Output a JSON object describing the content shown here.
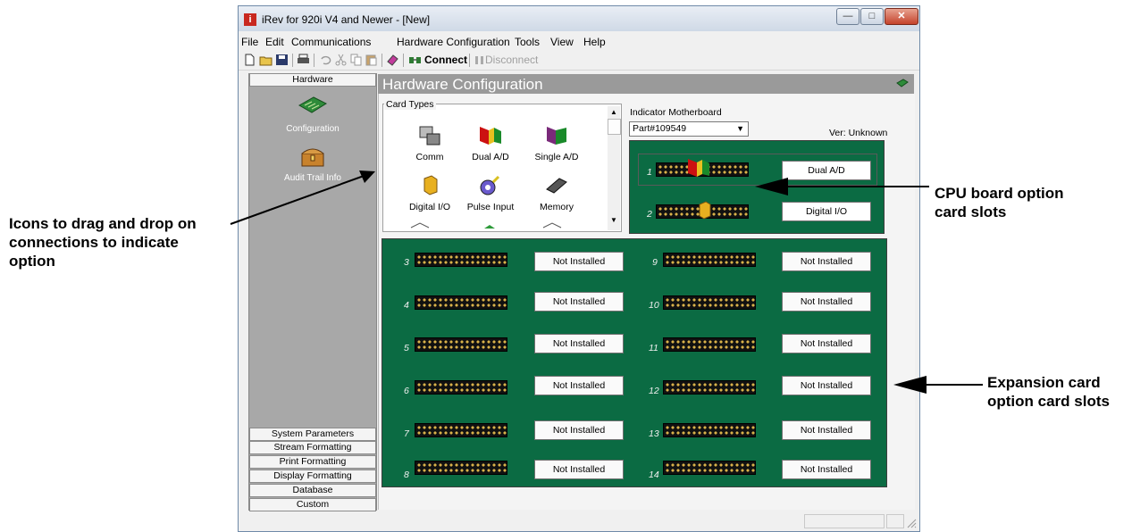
{
  "annotations": {
    "left_note": "Icons to drag and drop on\nconnections to indicate\noption",
    "cpu_note": "CPU board option\ncard slots",
    "exp_note": "Expansion card\noption card slots"
  },
  "window": {
    "title": "iRev for 920i V4 and Newer - [New]",
    "app_icon_letter": "i"
  },
  "menu": [
    "File",
    "Edit",
    "Communications",
    "Hardware Configuration",
    "Tools",
    "View",
    "Help"
  ],
  "toolbar": {
    "connect_label": "Connect",
    "disconnect_label": "Disconnect"
  },
  "sidebar": {
    "header": "Hardware",
    "icon_items": [
      {
        "label": "Configuration",
        "icon": "circuit-board-icon"
      },
      {
        "label": "Audit Trail Info",
        "icon": "treasure-chest-icon"
      }
    ],
    "bottom_items": [
      "System Parameters",
      "Stream Formatting",
      "Print Formatting",
      "Display Formatting",
      "Database",
      "Custom"
    ]
  },
  "page": {
    "title": "Hardware Configuration"
  },
  "card_types": {
    "legend": "Card Types",
    "items": [
      {
        "label": "Comm",
        "icon": "comm-card-icon"
      },
      {
        "label": "Dual A/D",
        "icon": "dual-ad-card-icon"
      },
      {
        "label": "Single A/D",
        "icon": "single-ad-card-icon"
      },
      {
        "label": "Digital I/O",
        "icon": "digital-io-card-icon"
      },
      {
        "label": "Pulse Input",
        "icon": "pulse-input-card-icon"
      },
      {
        "label": "Memory",
        "icon": "memory-card-icon"
      }
    ]
  },
  "motherboard": {
    "label": "Indicator Motherboard",
    "selected": "Part#109549",
    "version": "Ver: Unknown"
  },
  "cpu_slots": [
    {
      "num": "1",
      "label": "Dual A/D"
    },
    {
      "num": "2",
      "label": "Digital I/O"
    }
  ],
  "expansion_slots_left": [
    {
      "num": "3",
      "label": "Not Installed"
    },
    {
      "num": "4",
      "label": "Not Installed"
    },
    {
      "num": "5",
      "label": "Not Installed"
    },
    {
      "num": "6",
      "label": "Not Installed"
    },
    {
      "num": "7",
      "label": "Not Installed"
    },
    {
      "num": "8",
      "label": "Not Installed"
    }
  ],
  "expansion_slots_right": [
    {
      "num": "9",
      "label": "Not Installed"
    },
    {
      "num": "10",
      "label": "Not Installed"
    },
    {
      "num": "11",
      "label": "Not Installed"
    },
    {
      "num": "12",
      "label": "Not Installed"
    },
    {
      "num": "13",
      "label": "Not Installed"
    },
    {
      "num": "14",
      "label": "Not Installed"
    }
  ],
  "colors": {
    "board_green": "#0b6b43",
    "nav_gray": "#a8a8a8"
  }
}
